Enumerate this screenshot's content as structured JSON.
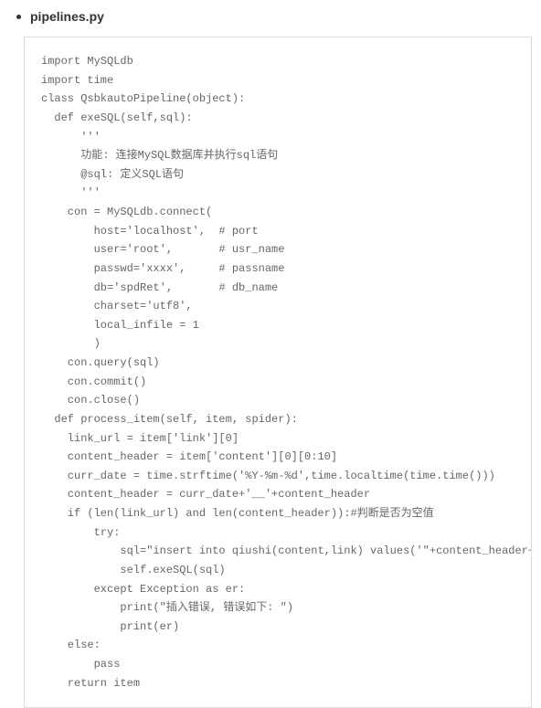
{
  "heading": {
    "filename": "pipelines.py"
  },
  "code": "import MySQLdb\nimport time\nclass QsbkautoPipeline(object):\n  def exeSQL(self,sql):\n      '''\n      功能: 连接MySQL数据库并执行sql语句\n      @sql: 定义SQL语句\n      '''\n    con = MySQLdb.connect(\n        host='localhost',  # port\n        user='root',       # usr_name\n        passwd='xxxx',     # passname\n        db='spdRet',       # db_name\n        charset='utf8',\n        local_infile = 1\n        )\n    con.query(sql)\n    con.commit()\n    con.close()\n  def process_item(self, item, spider):\n    link_url = item['link'][0]\n    content_header = item['content'][0][0:10]\n    curr_date = time.strftime('%Y-%m-%d',time.localtime(time.time()))\n    content_header = curr_date+'__'+content_header\n    if (len(link_url) and len(content_header)):#判断是否为空值\n        try:\n            sql=\"insert into qiushi(content,link) values('\"+content_header+\"','\"+link\n            self.exeSQL(sql)\n        except Exception as er:\n            print(\"插入错误, 错误如下: \")\n            print(er)\n    else:\n        pass\n    return item"
}
